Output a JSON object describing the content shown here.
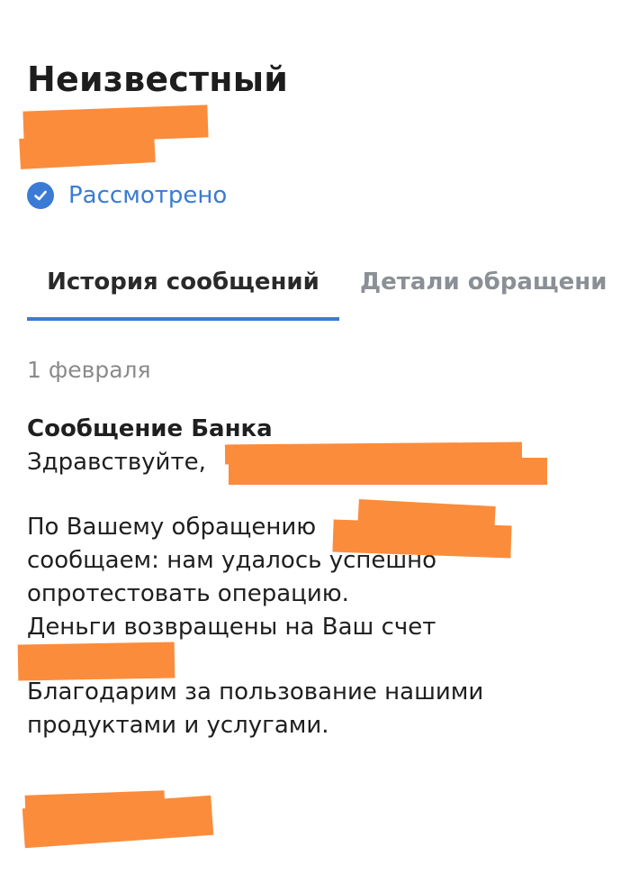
{
  "header": {
    "title": "Неизвестный"
  },
  "status": {
    "icon": "check-circle-icon",
    "text": "Рассмотрено",
    "color": "#3a7bd5"
  },
  "tabs": {
    "items": [
      {
        "label": "История сообщений",
        "active": true
      },
      {
        "label": "Детали обращени",
        "active": false
      }
    ],
    "accent_color": "#3a7bd5"
  },
  "message": {
    "date": "1 февраля",
    "sender": "Сообщение Банка",
    "greeting": "Здравствуйте,",
    "line1": "По Вашему обращению",
    "line2": "сообщаем: нам удалось успешно",
    "line3": "опротестовать операцию.",
    "line4": "Деньги возвращены на Ваш счет",
    "line5": "Благодарим за пользование нашими",
    "line6": "продуктами и услугами."
  },
  "redaction_color": "#fb8c3c"
}
